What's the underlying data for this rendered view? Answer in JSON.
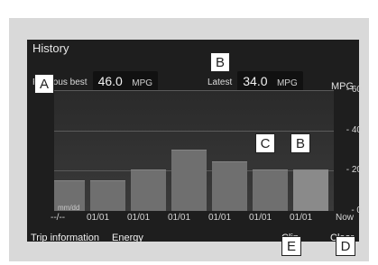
{
  "screen": {
    "title": "History",
    "previous_best": {
      "label": "Previous best",
      "value": "46.0",
      "unit": "MPG"
    },
    "latest": {
      "label": "Latest",
      "value": "34.0",
      "unit": "MPG"
    },
    "y_axis_unit": "MPG",
    "y_ticks": [
      "60",
      "40",
      "20",
      "0"
    ],
    "x_start": "--/--",
    "x_labels": [
      "01/01",
      "01/01",
      "01/01",
      "01/01",
      "01/01",
      "01/01"
    ],
    "x_end": "Now",
    "date_format_label": "mm/dd",
    "tabs": [
      "Trip information",
      "Energy"
    ],
    "actions": {
      "clip": "Clip",
      "clear": "Clear"
    }
  },
  "callouts": {
    "A": "A",
    "B_top": "B",
    "C": "C",
    "B_bar": "B",
    "E": "E",
    "D": "D"
  },
  "chart_data": {
    "type": "bar",
    "categories": [
      "01/01",
      "01/01",
      "01/01",
      "01/01",
      "01/01",
      "01/01"
    ],
    "values": [
      15,
      20,
      30,
      24,
      20,
      20
    ],
    "ylim": [
      0,
      60
    ]
  }
}
